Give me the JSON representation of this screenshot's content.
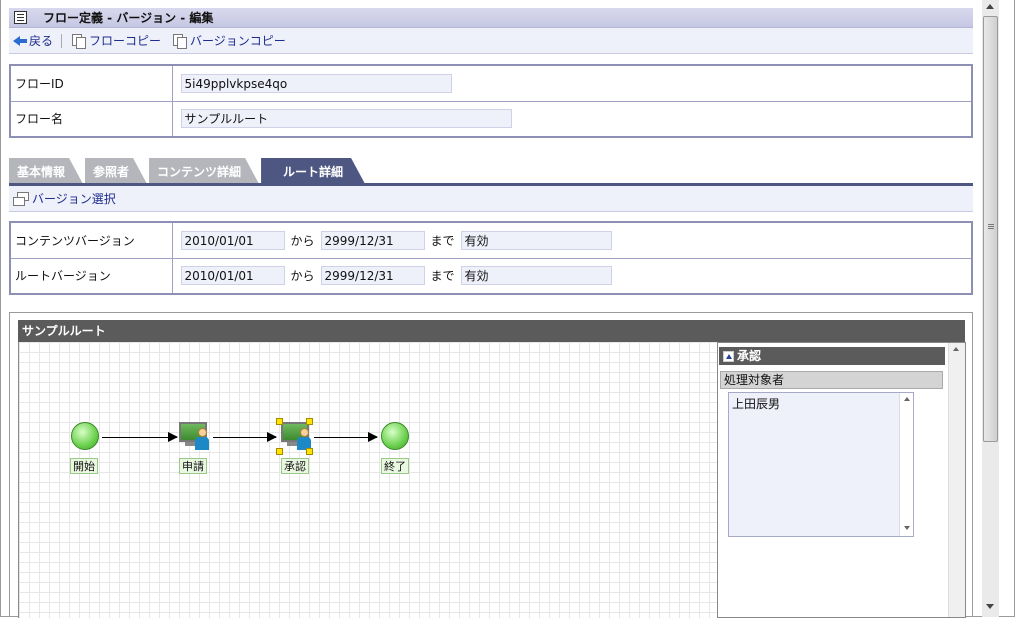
{
  "header": {
    "title": "フロー定義 - バージョン - 編集",
    "icon": "document-icon"
  },
  "toolbar": {
    "back": "戻る",
    "flow_copy": "フローコピー",
    "version_copy": "バージョンコピー"
  },
  "flow_info": {
    "id_label": "フローID",
    "id_value": "5i49pplvkpse4qo",
    "name_label": "フロー名",
    "name_value": "サンプルルート"
  },
  "tabs": [
    {
      "label": "基本情報",
      "active": false
    },
    {
      "label": "参照者",
      "active": false
    },
    {
      "label": "コンテンツ詳細",
      "active": false
    },
    {
      "label": "ルート詳細",
      "active": true
    }
  ],
  "subbar": {
    "version_select": "バージョン選択"
  },
  "versions": {
    "from_word": "から",
    "to_word": "まで",
    "rows": [
      {
        "label": "コンテンツバージョン",
        "start": "2010/01/01",
        "end": "2999/12/31",
        "status": "有効"
      },
      {
        "label": "ルートバージョン",
        "start": "2010/01/01",
        "end": "2999/12/31",
        "status": "有効"
      }
    ]
  },
  "route": {
    "title": "サンプルルート",
    "nodes": [
      "開始",
      "申請",
      "承認",
      "終了"
    ]
  },
  "panel": {
    "title": "承認",
    "section": "処理対象者",
    "assignees": [
      "上田辰男"
    ]
  },
  "colors": {
    "accent": "#4e5782",
    "node_green": "#6ad04c",
    "panel_header": "#5b5b5b"
  }
}
